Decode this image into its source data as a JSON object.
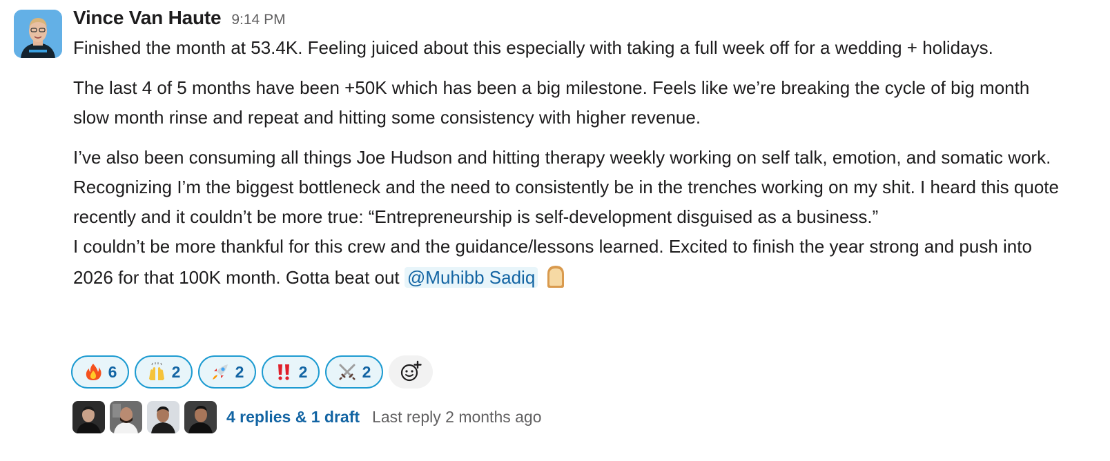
{
  "message": {
    "author": "Vince Van Haute",
    "timestamp": "9:14 PM",
    "paragraphs": [
      "Finished the month at 53.4K. Feeling juiced about this especially with taking a full week off for a wedding + holidays.",
      "The last 4 of 5 months have been +50K which has been a big milestone. Feels like we’re breaking the cycle of big month slow month rinse and repeat and hitting some consistency with higher revenue.",
      "I’ve also been consuming all things Joe Hudson and hitting therapy weekly working on self talk, emotion, and somatic work. Recognizing I’m the biggest bottleneck and the need to consistently be in the trenches working on my shit. I heard this quote recently and it couldn’t be more true: “Entrepreneurship is self-development disguised as a business.”",
      "I couldn’t be more thankful for this crew and the guidance/lessons learned. Excited to finish the year strong and push into 2026 for that 100K month. Gotta beat out "
    ],
    "mention": "@Muhibb Sadiq",
    "trailing_emoji": "bread-emoji"
  },
  "reactions": [
    {
      "emoji": "fire-emoji",
      "count": "6"
    },
    {
      "emoji": "raised-hands-emoji",
      "count": "2"
    },
    {
      "emoji": "rocket-emoji",
      "count": "2"
    },
    {
      "emoji": "double-exclamation-emoji",
      "count": "2"
    },
    {
      "emoji": "crossed-swords-emoji",
      "count": "2"
    }
  ],
  "add_reaction_icon": "add-reaction-icon",
  "thread": {
    "replies_label": "4 replies & 1 draft",
    "last_reply": "Last reply 2 months ago"
  },
  "colors": {
    "link": "#1264a3",
    "reaction_border": "#1d9bd1",
    "reaction_bg": "#e8f5fa",
    "muted_text": "#616061"
  }
}
